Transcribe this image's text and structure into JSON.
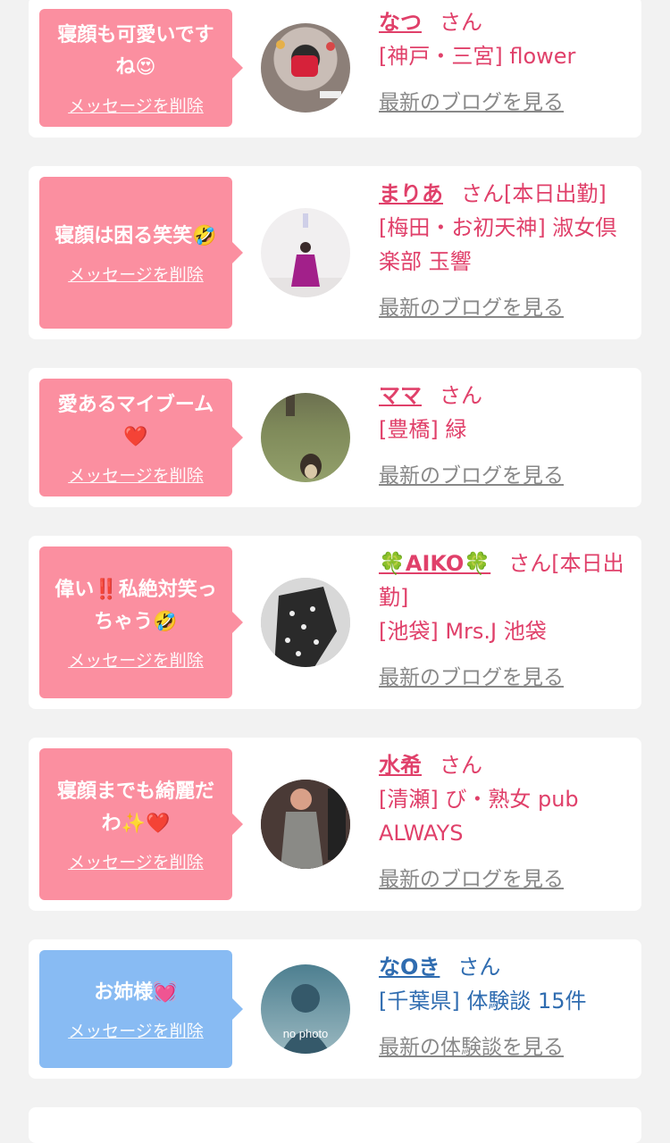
{
  "cards": [
    {
      "message": "寝顔も可愛いですね😍",
      "delete_label": "メッセージを削除",
      "name": "なつ",
      "suffix": "さん",
      "shop": "[神戸・三宮] flower",
      "link": "最新のブログを見る",
      "theme": "pink"
    },
    {
      "message": "寝顔は困る笑笑🤣",
      "delete_label": "メッセージを削除",
      "name": "まりあ",
      "suffix": "さん[本日出勤]",
      "shop": "[梅田・お初天神] 淑女倶楽部 玉響",
      "link": "最新のブログを見る",
      "theme": "pink"
    },
    {
      "message": "愛あるマイブーム❤️",
      "delete_label": "メッセージを削除",
      "name": "ママ",
      "suffix": "さん",
      "shop": "[豊橋] 緑",
      "link": "最新のブログを見る",
      "theme": "pink"
    },
    {
      "message": "偉い‼️私絶対笑っちゃう🤣",
      "delete_label": "メッセージを削除",
      "name": "🍀AIKO🍀",
      "suffix": "さん[本日出勤]",
      "shop": "[池袋] Mrs.J 池袋",
      "link": "最新のブログを見る",
      "theme": "pink"
    },
    {
      "message": "寝顔までも綺麗だわ✨❤️",
      "delete_label": "メッセージを削除",
      "name": "水希",
      "suffix": "さん",
      "shop": "[清瀬] び・熟女 pub ALWAYS",
      "link": "最新のブログを見る",
      "theme": "pink"
    },
    {
      "message": "お姉様💓",
      "delete_label": "メッセージを削除",
      "name": "なOき",
      "suffix": "さん",
      "shop": "[千葉県] 体験談 15件",
      "link": "最新の体験談を見る",
      "theme": "blue",
      "avatar_text": "no photo"
    }
  ],
  "colors": {
    "pink_bubble": "#fb8fa0",
    "blue_bubble": "#88bbf3",
    "pink_text": "#e0406a",
    "blue_text": "#2f6cb0"
  }
}
